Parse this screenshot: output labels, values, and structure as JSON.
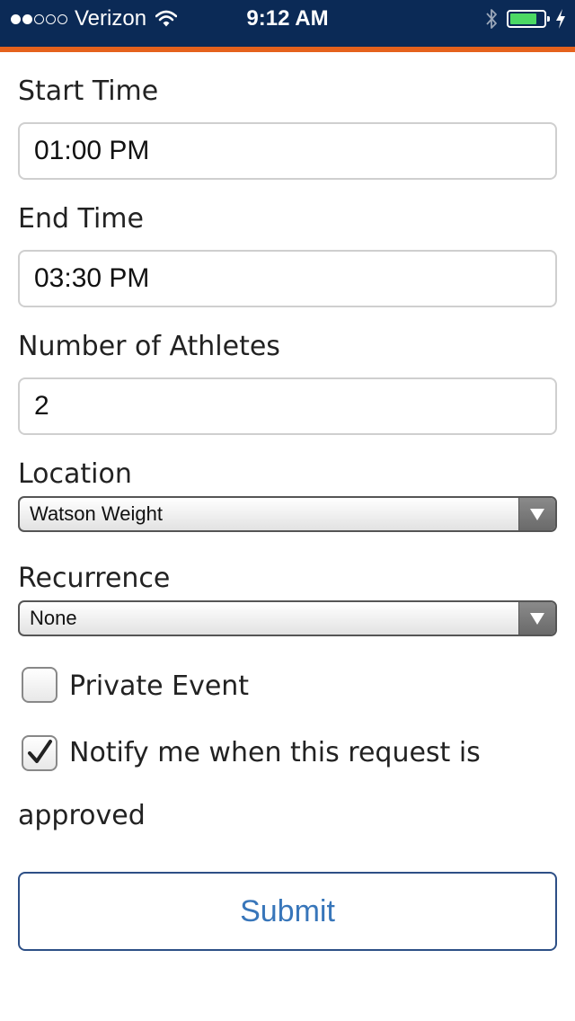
{
  "status_bar": {
    "carrier": "Verizon",
    "signal_bars_filled": 2,
    "signal_bars_total": 5,
    "time": "9:12 AM",
    "battery_level": 0.8,
    "colors": {
      "background": "#0b2a56",
      "accent": "#e5621d",
      "battery": "#4cd964"
    }
  },
  "form": {
    "start_time": {
      "label": "Start Time",
      "value": "01:00 PM"
    },
    "end_time": {
      "label": "End Time",
      "value": "03:30 PM"
    },
    "athletes": {
      "label": "Number of Athletes",
      "value": "2"
    },
    "location": {
      "label": "Location",
      "selected": "Watson Weight"
    },
    "recurrence": {
      "label": "Recurrence",
      "selected": "None"
    },
    "private_event": {
      "label": "Private Event",
      "checked": false
    },
    "notify": {
      "label": "Notify me when this request is approved",
      "checked": true
    },
    "submit_label": "Submit"
  }
}
